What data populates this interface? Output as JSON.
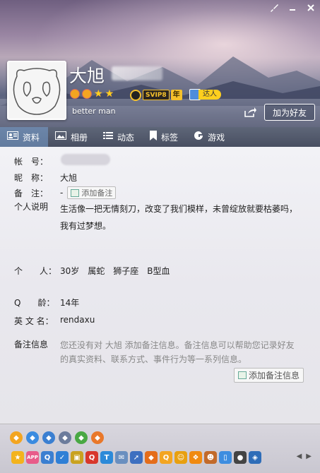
{
  "window": {
    "skin_icon": "brush-icon",
    "minimize_icon": "minimize-icon",
    "close_icon": "close-icon"
  },
  "profile": {
    "nickname": "大旭",
    "signature": "better man",
    "svip_label": "SVIP8",
    "year_label": "年",
    "daren_label": "达人",
    "add_friend_label": "加为好友"
  },
  "tabs": [
    {
      "label": "资料",
      "icon": "profile-card-icon"
    },
    {
      "label": "相册",
      "icon": "photo-album-icon"
    },
    {
      "label": "动态",
      "icon": "feed-list-icon"
    },
    {
      "label": "标签",
      "icon": "bookmark-icon"
    },
    {
      "label": "游戏",
      "icon": "game-icon"
    }
  ],
  "info": {
    "account_label": "帐　号：",
    "nickname_label": "昵　称：",
    "nickname_value": "大旭",
    "remark_label": "备　注：",
    "remark_value": "-",
    "add_remark_inline": "添加备注",
    "bio_label": "个人说明",
    "bio_line1": "生活像一把无情刻刀，改变了我们模样，未曾绽放就要枯萎吗，",
    "bio_line2": "我有过梦想。",
    "personal_label": "个　　人：",
    "personal_value": "30岁　属蛇　狮子座　B型血",
    "qage_label": "Q　　龄：",
    "qage_value": "14年",
    "english_label": "英 文 名：",
    "english_value": "rendaxu",
    "note_info_label": "备注信息",
    "note_hint_line1": "您还没有对 大旭 添加备注信息。备注信息可以帮助您记录好友",
    "note_hint_line2": "的真实资料、联系方式、事件行为等一系列信息。",
    "add_note_button": "添加备注信息"
  },
  "toolbar_row1": [
    "crown-icon",
    "diamond-icon",
    "star-badge-icon",
    "diamond2-icon",
    "green-diamond-icon",
    "game-center-icon"
  ],
  "toolbar_row2": [
    {
      "name": "star-icon",
      "color": "#f3b31d",
      "text": "★"
    },
    {
      "name": "app-icon",
      "color": "#e85c8a",
      "text": "APP"
    },
    {
      "name": "qzone-icon",
      "color": "#3b7fd1",
      "text": "Q"
    },
    {
      "name": "shield-icon",
      "color": "#2f7fd6",
      "text": "✓"
    },
    {
      "name": "gift-icon",
      "color": "#c9a21f",
      "text": "▣"
    },
    {
      "name": "red-badge-icon",
      "color": "#d8372b",
      "text": "Q"
    },
    {
      "name": "tencent-icon",
      "color": "#2c8ad9",
      "text": "T"
    },
    {
      "name": "envelope-icon",
      "color": "#6a8fbf",
      "text": "✉"
    },
    {
      "name": "rocket-icon",
      "color": "#3d6fc0",
      "text": "➚"
    },
    {
      "name": "penguin-game-icon",
      "color": "#e46d1b",
      "text": "◆"
    },
    {
      "name": "coin-icon",
      "color": "#f3a521",
      "text": "Q"
    },
    {
      "name": "pet-icon",
      "color": "#e8a010",
      "text": "☺"
    },
    {
      "name": "treasure-icon",
      "color": "#f08a10",
      "text": "❖"
    },
    {
      "name": "monkey-icon",
      "color": "#c26a2a",
      "text": "☻"
    },
    {
      "name": "phone-icon",
      "color": "#3d8de0",
      "text": "▯"
    },
    {
      "name": "penguin-icon",
      "color": "#444",
      "text": "●"
    },
    {
      "name": "tag-icon",
      "color": "#2e6db8",
      "text": "◈"
    }
  ],
  "nav": {
    "prev": "◀",
    "next": "▶"
  }
}
